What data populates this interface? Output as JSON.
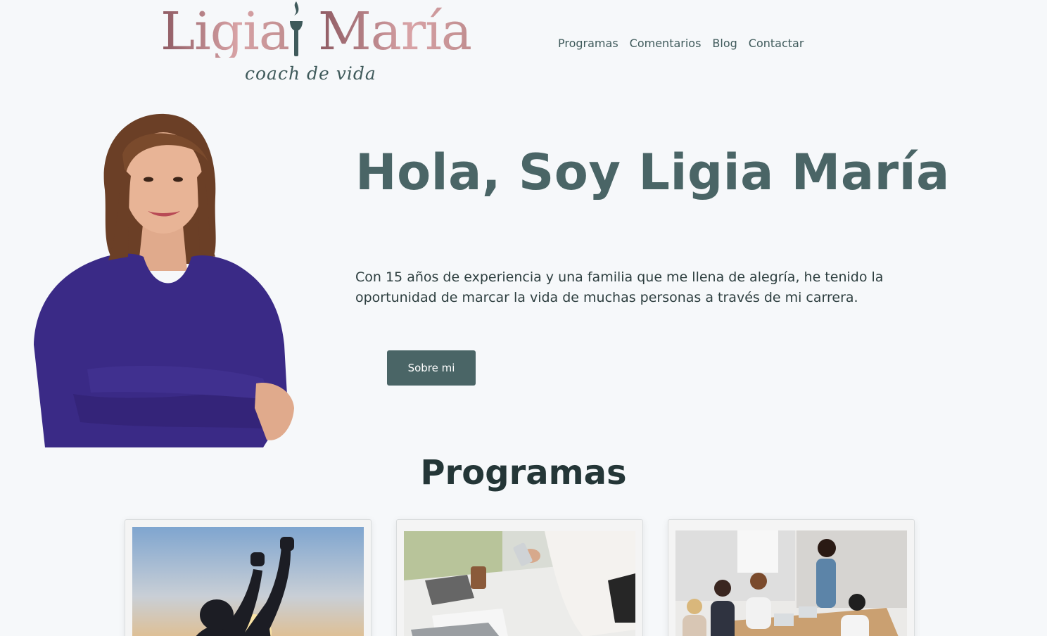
{
  "brand": {
    "first_name": "Ligia",
    "last_name": "María",
    "tagline": "coach de vida",
    "colors": {
      "logo_rose": "#c0878c",
      "logo_dark": "#8e5a62",
      "torch": "#3f5a5b"
    }
  },
  "nav": {
    "items": [
      {
        "label": "Programas"
      },
      {
        "label": "Comentarios"
      },
      {
        "label": "Blog"
      },
      {
        "label": "Contactar"
      }
    ]
  },
  "hero": {
    "title": "Hola, Soy Ligia María",
    "text": "Con 15 años de experiencia y una familia que me llena de alegría, he tenido la oportunidad de marcar la vida de muchas personas a través de mi carrera.",
    "button_label": "Sobre mi"
  },
  "programs": {
    "title": "Programas",
    "cards": [
      {
        "image": "woman-raising-fists-at-sunset"
      },
      {
        "image": "person-with-phone-at-desk"
      },
      {
        "image": "team-meeting-around-table"
      }
    ]
  },
  "colors": {
    "background": "#f6f8fa",
    "accent": "#4a6566",
    "text": "#2d3e3f"
  }
}
